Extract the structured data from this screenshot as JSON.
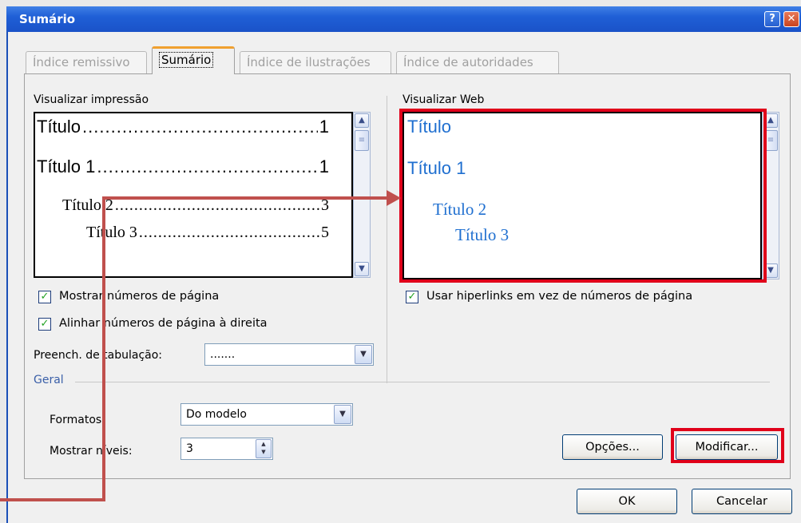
{
  "window": {
    "title": "Sumário"
  },
  "tabs": [
    {
      "label": "Índice remissivo"
    },
    {
      "label": "Sumário"
    },
    {
      "label": "Índice de ilustrações"
    },
    {
      "label": "Índice de autoridades"
    }
  ],
  "print_preview": {
    "label": "Visualizar impressão",
    "entries": [
      {
        "text": "Título",
        "page": "1"
      },
      {
        "text": "Título 1",
        "page": "1"
      },
      {
        "text": "Título 2",
        "page": "3"
      },
      {
        "text": "Título 3",
        "page": "5"
      }
    ]
  },
  "web_preview": {
    "label": "Visualizar Web",
    "entries": [
      "Título",
      "Título 1",
      "Título 2",
      "Título 3"
    ]
  },
  "options": {
    "show_page_numbers": {
      "label": "Mostrar números de página",
      "checked": true
    },
    "right_align": {
      "label": "Alinhar números de página à direita",
      "checked": true
    },
    "use_hyperlinks": {
      "label": "Usar hiperlinks em vez de números de página",
      "checked": true
    },
    "tab_leader": {
      "label": "Preench. de tabulação:",
      "value": "......."
    }
  },
  "general": {
    "legend": "Geral",
    "formats": {
      "label": "Formatos:",
      "value": "Do modelo"
    },
    "show_levels": {
      "label": "Mostrar níveis:",
      "value": "3"
    }
  },
  "buttons": {
    "options": "Opções...",
    "modify": "Modificar...",
    "ok": "OK",
    "cancel": "Cancelar"
  },
  "annotation_color": "#c0504d",
  "highlight_color": "#e0001a"
}
